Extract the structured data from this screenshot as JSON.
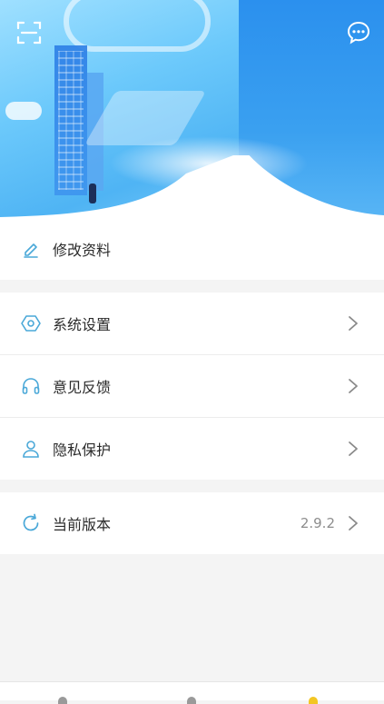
{
  "header": {
    "scan_icon": "scan-icon",
    "message_icon": "chat-bubble-icon"
  },
  "menu": {
    "edit_profile": {
      "label": "修改资料",
      "icon": "pencil-icon"
    },
    "system_settings": {
      "label": "系统设置",
      "icon": "hexagon-settings-icon"
    },
    "feedback": {
      "label": "意见反馈",
      "icon": "headphones-icon"
    },
    "privacy": {
      "label": "隐私保护",
      "icon": "user-icon"
    },
    "version": {
      "label": "当前版本",
      "value": "2.9.2",
      "icon": "refresh-icon"
    }
  },
  "colors": {
    "accent": "#4aa8d8",
    "hero_blue": "#4fb4f4",
    "text": "#2b2b2b",
    "muted": "#8d8d8d"
  }
}
